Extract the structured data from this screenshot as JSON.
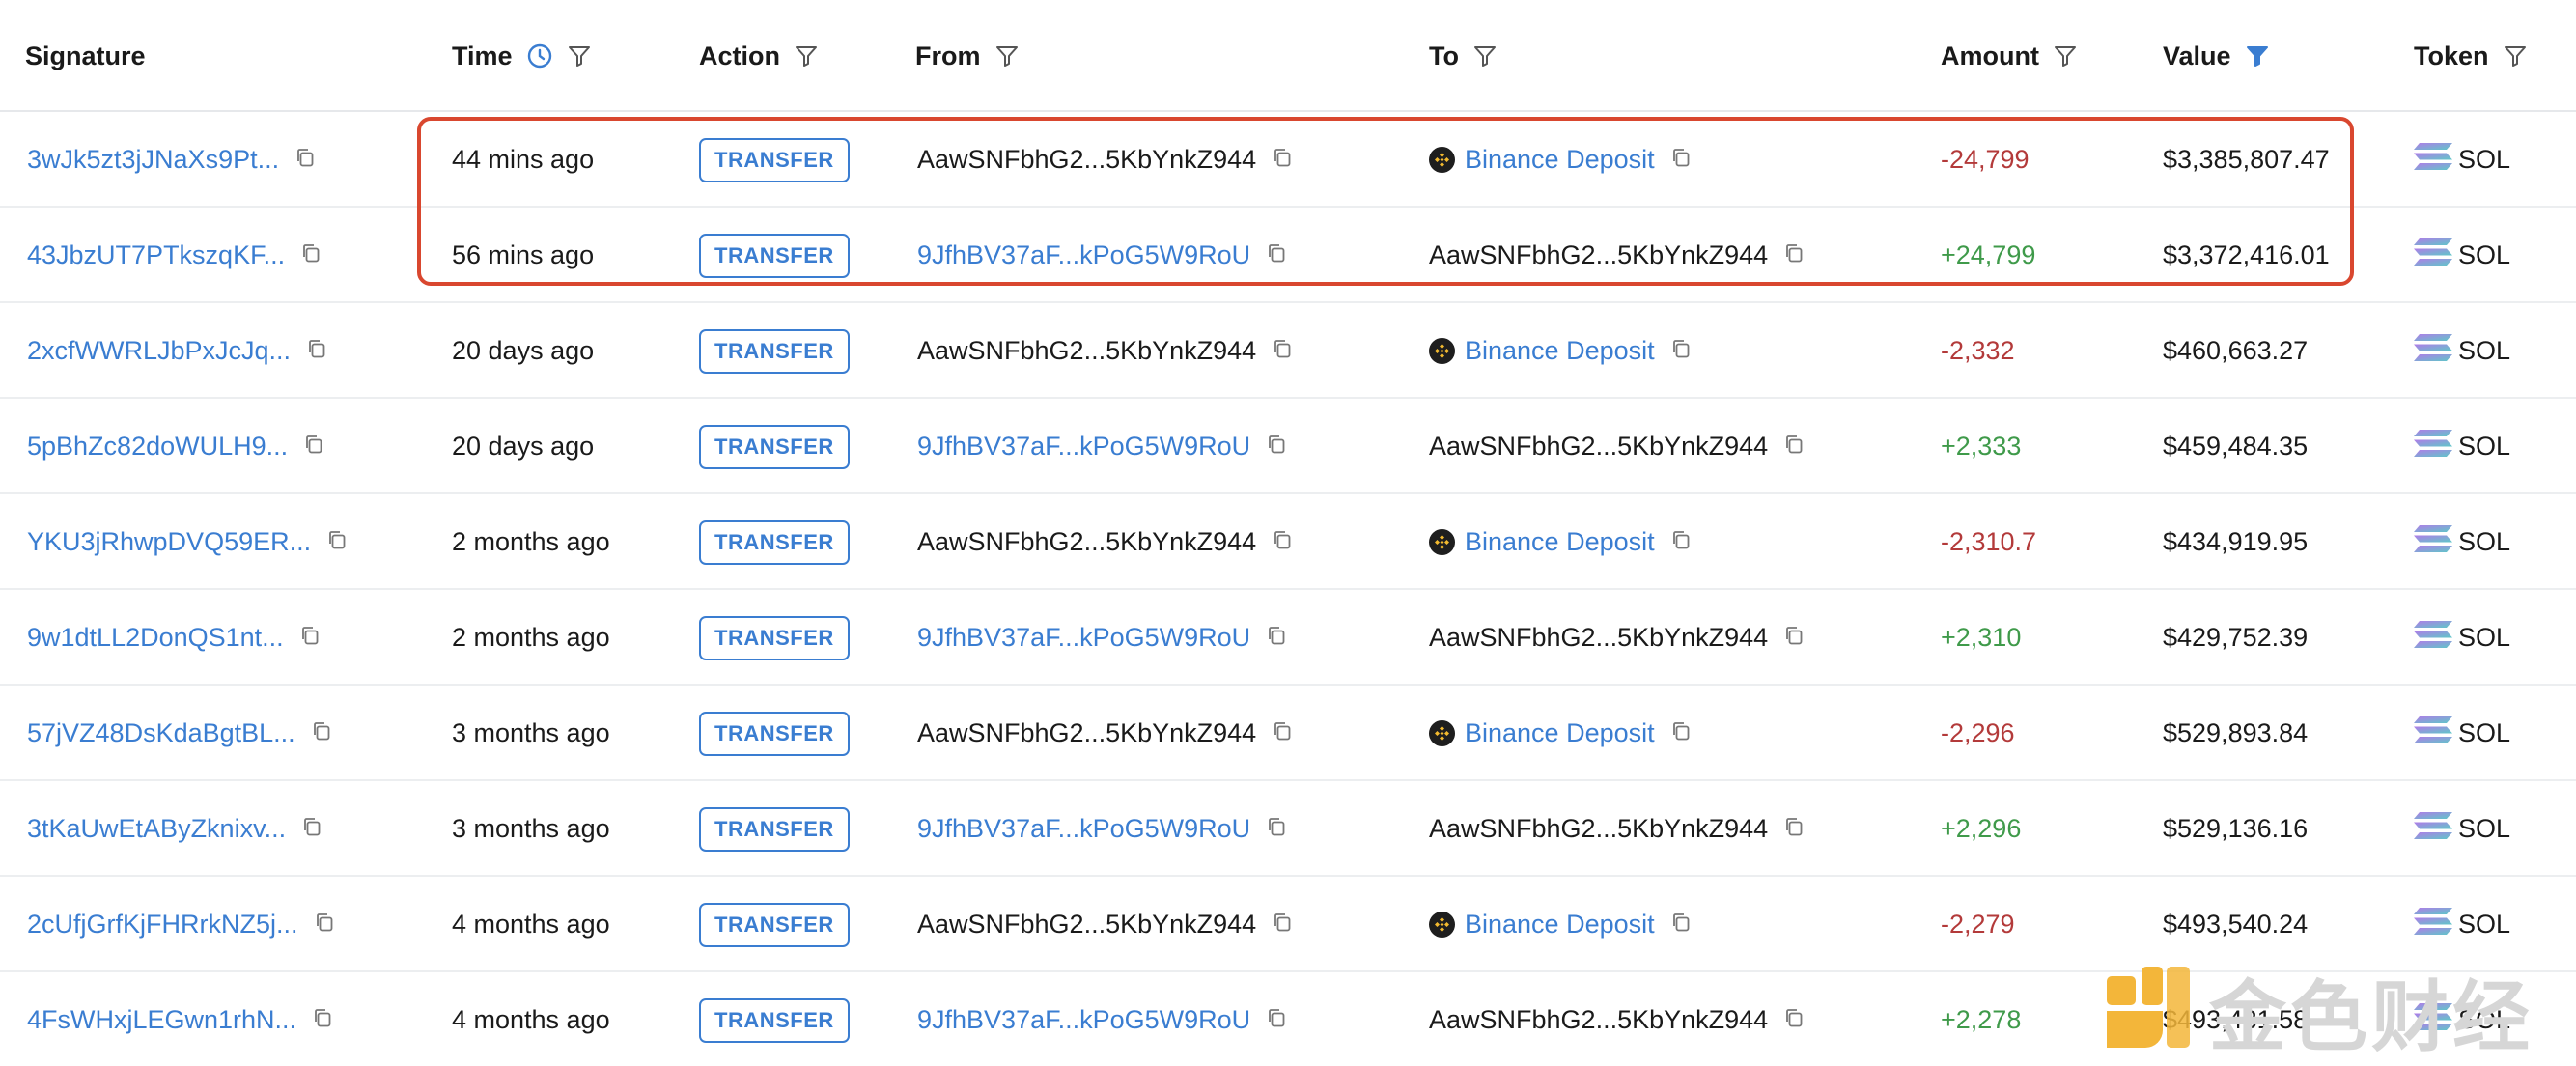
{
  "headers": {
    "signature": "Signature",
    "time": "Time",
    "action": "Action",
    "from": "From",
    "to": "To",
    "amount": "Amount",
    "value": "Value",
    "token": "Token"
  },
  "colors": {
    "link": "#3a7dd1",
    "negative": "#b33a3a",
    "positive": "#3f9a4a",
    "highlight_border": "#d9472f",
    "active_filter": "#3a7dd1"
  },
  "icons": {
    "time_sort": "clock-icon",
    "filter": "filter-icon",
    "copy": "copy-icon",
    "binance": "bnb-logo-icon",
    "solana": "sol-logo-icon"
  },
  "rows": [
    {
      "signature": "3wJk5zt3jJNaXs9Pt...",
      "time": "44 mins ago",
      "action": "TRANSFER",
      "from": "AawSNFbhG2...5KbYnkZ944",
      "to": "Binance Deposit",
      "amount": "-24,799",
      "value": "$3,385,807.47",
      "token": "SOL"
    },
    {
      "signature": "43JbzUT7PTkszqKF...",
      "time": "56 mins ago",
      "action": "TRANSFER",
      "from": "9JfhBV37aF...kPoG5W9RoU",
      "to": "AawSNFbhG2...5KbYnkZ944",
      "amount": "+24,799",
      "value": "$3,372,416.01",
      "token": "SOL"
    },
    {
      "signature": "2xcfWWRLJbPxJcJq...",
      "time": "20 days ago",
      "action": "TRANSFER",
      "from": "AawSNFbhG2...5KbYnkZ944",
      "to": "Binance Deposit",
      "amount": "-2,332",
      "value": "$460,663.27",
      "token": "SOL"
    },
    {
      "signature": "5pBhZc82doWULH9...",
      "time": "20 days ago",
      "action": "TRANSFER",
      "from": "9JfhBV37aF...kPoG5W9RoU",
      "to": "AawSNFbhG2...5KbYnkZ944",
      "amount": "+2,333",
      "value": "$459,484.35",
      "token": "SOL"
    },
    {
      "signature": "YKU3jRhwpDVQ59ER...",
      "time": "2 months ago",
      "action": "TRANSFER",
      "from": "AawSNFbhG2...5KbYnkZ944",
      "to": "Binance Deposit",
      "amount": "-2,310.7",
      "value": "$434,919.95",
      "token": "SOL"
    },
    {
      "signature": "9w1dtLL2DonQS1nt...",
      "time": "2 months ago",
      "action": "TRANSFER",
      "from": "9JfhBV37aF...kPoG5W9RoU",
      "to": "AawSNFbhG2...5KbYnkZ944",
      "amount": "+2,310",
      "value": "$429,752.39",
      "token": "SOL"
    },
    {
      "signature": "57jVZ48DsKdaBgtBL...",
      "time": "3 months ago",
      "action": "TRANSFER",
      "from": "AawSNFbhG2...5KbYnkZ944",
      "to": "Binance Deposit",
      "amount": "-2,296",
      "value": "$529,893.84",
      "token": "SOL"
    },
    {
      "signature": "3tKaUwEtAByZknixv...",
      "time": "3 months ago",
      "action": "TRANSFER",
      "from": "9JfhBV37aF...kPoG5W9RoU",
      "to": "AawSNFbhG2...5KbYnkZ944",
      "amount": "+2,296",
      "value": "$529,136.16",
      "token": "SOL"
    },
    {
      "signature": "2cUfjGrfKjFHRrkNZ5j...",
      "time": "4 months ago",
      "action": "TRANSFER",
      "from": "AawSNFbhG2...5KbYnkZ944",
      "to": "Binance Deposit",
      "amount": "-2,279",
      "value": "$493,540.24",
      "token": "SOL"
    },
    {
      "signature": "4FsWHxjLEGwn1rhN...",
      "time": "4 months ago",
      "action": "TRANSFER",
      "from": "9JfhBV37aF...kPoG5W9RoU",
      "to": "AawSNFbhG2...5KbYnkZ944",
      "amount": "+2,278",
      "value": "$493,431.58",
      "token": "SOL"
    }
  ],
  "watermark": {
    "text": "金色财经"
  }
}
